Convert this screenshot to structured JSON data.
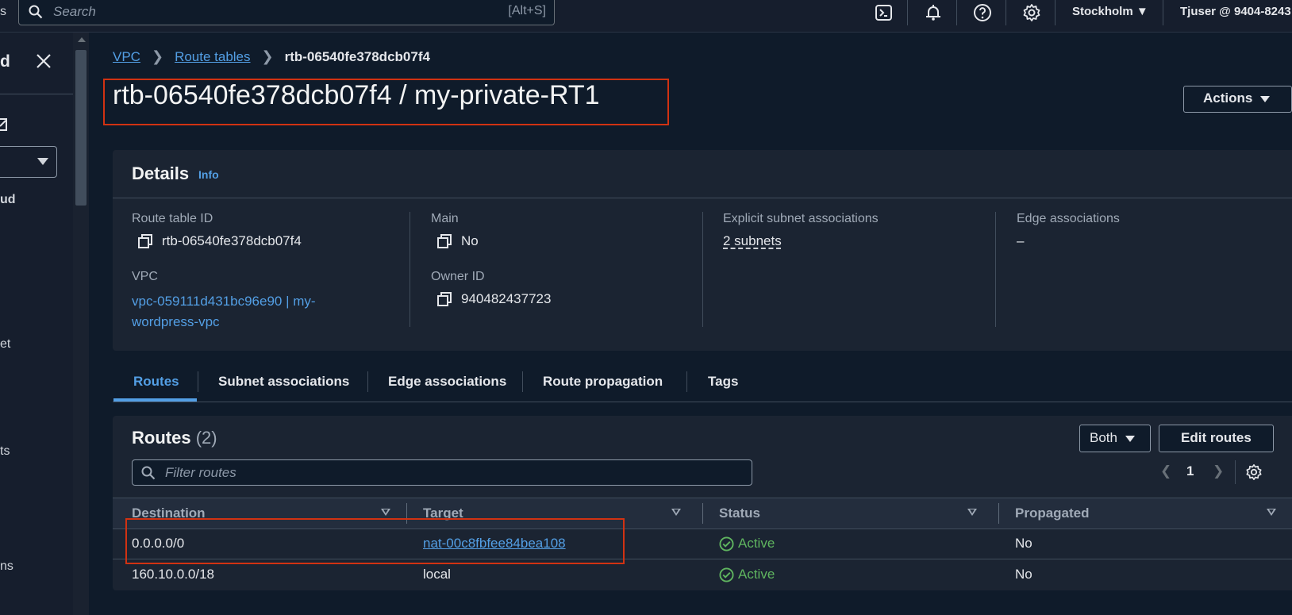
{
  "topnav": {
    "search_placeholder": "Search",
    "search_shortcut": "[Alt+S]",
    "region": "Stockholm",
    "user": "Tjuser @ 9404-8243",
    "icons": [
      "cloudshell-icon",
      "bell-icon",
      "help-icon",
      "settings-icon"
    ]
  },
  "drawer": {
    "title_fragment": "d",
    "fragments": [
      "ud",
      "et",
      "ts",
      "ns"
    ]
  },
  "breadcrumb": {
    "items": [
      "VPC",
      "Route tables"
    ],
    "current": "rtb-06540fe378dcb07f4"
  },
  "page": {
    "title": "rtb-06540fe378dcb07f4 / my-private-RT1",
    "actions_label": "Actions"
  },
  "details": {
    "title": "Details",
    "info_label": "Info",
    "route_table_id_label": "Route table ID",
    "route_table_id": "rtb-06540fe378dcb07f4",
    "vpc_label": "VPC",
    "vpc_value_line1": "vpc-059111d431bc96e90 | my-",
    "vpc_value_line2": "wordpress-vpc",
    "main_label": "Main",
    "main_value": "No",
    "owner_label": "Owner ID",
    "owner_value": "940482437723",
    "explicit_label": "Explicit subnet associations",
    "explicit_value": "2 subnets",
    "edge_label": "Edge associations",
    "edge_value": "–"
  },
  "tabs": [
    "Routes",
    "Subnet associations",
    "Edge associations",
    "Route propagation",
    "Tags"
  ],
  "routes": {
    "title": "Routes",
    "count": "(2)",
    "filter_label": "Both",
    "edit_label": "Edit routes",
    "filter_placeholder": "Filter routes",
    "page": "1",
    "columns": [
      "Destination",
      "Target",
      "Status",
      "Propagated"
    ],
    "rows": [
      {
        "destination": "0.0.0.0/0",
        "target": "nat-00c8fbfee84bea108",
        "status": "Active",
        "propagated": "No"
      },
      {
        "destination": "160.10.0.0/18",
        "target": "local",
        "status": "Active",
        "propagated": "No"
      }
    ]
  },
  "colors": {
    "background": "#0f1b2a",
    "link": "#539fe5",
    "success": "#5fb45f",
    "highlight": "#d13212"
  }
}
